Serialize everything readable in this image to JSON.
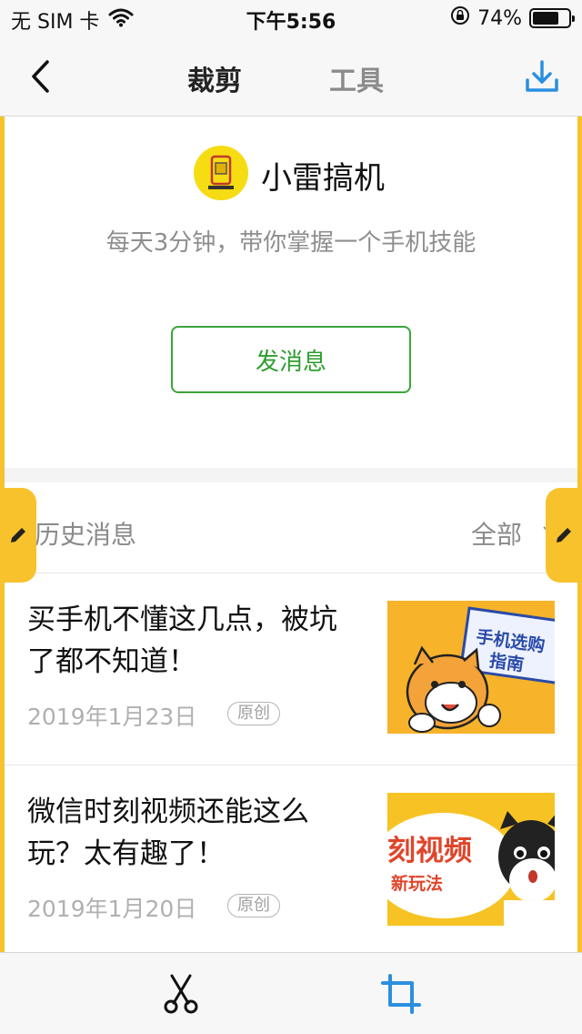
{
  "status_bar": {
    "carrier": "无 SIM 卡",
    "time": "下午5:56",
    "battery_text": "74%",
    "battery_level": 0.74
  },
  "nav": {
    "active_tab": "裁剪",
    "other_tab": "工具",
    "icons": {
      "back": "chevron-left-icon",
      "download": "download-icon"
    },
    "accent_color": "#2b8fe0"
  },
  "profile": {
    "name": "小雷搞机",
    "description": "每天3分钟，带你掌握一个手机技能",
    "message_button": "发消息",
    "button_color": "#3aa53a"
  },
  "history": {
    "title": "历史消息",
    "filter": "全部"
  },
  "articles": [
    {
      "title": "买手机不懂这几点，被坑了都不知道！",
      "date": "2019年1月23日",
      "badge": "原创",
      "thumb_text": "手机选购指南"
    },
    {
      "title": "微信时刻视频还能这么玩？太有趣了！",
      "date": "2019年1月20日",
      "badge": "原创",
      "thumb_text_1": "刻视频",
      "thumb_text_2": "新玩法"
    }
  ],
  "toolbar": {
    "icons": {
      "cut": "scissors-icon",
      "crop": "crop-icon"
    }
  },
  "highlight_color": "#f7c22c"
}
